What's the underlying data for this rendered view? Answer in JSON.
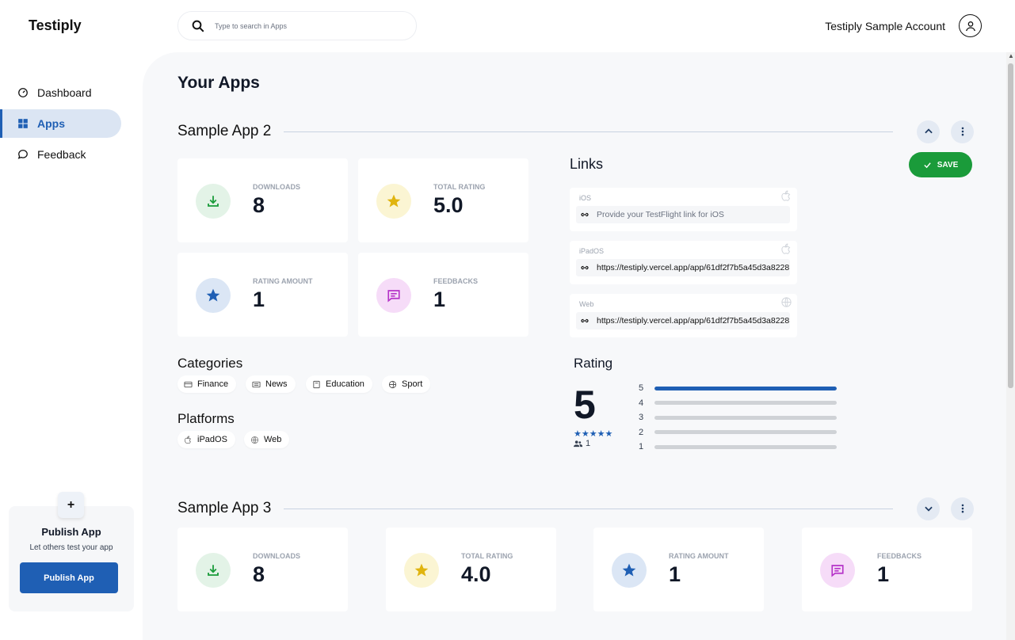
{
  "brand": "Testiply",
  "search": {
    "placeholder": "Type to search in Apps"
  },
  "account": {
    "name": "Testiply Sample Account"
  },
  "nav": {
    "items": [
      {
        "label": "Dashboard",
        "icon": "dashboard-icon"
      },
      {
        "label": "Apps",
        "icon": "grid-icon",
        "active": true
      },
      {
        "label": "Feedback",
        "icon": "chat-icon"
      }
    ]
  },
  "publish": {
    "plus": "+",
    "title": "Publish App",
    "subtitle": "Let others test your app",
    "button": "Publish App"
  },
  "page_title": "Your Apps",
  "apps": [
    {
      "name": "Sample App 2",
      "expanded": true,
      "stats": [
        {
          "label": "DOWNLOADS",
          "value": "8",
          "icon": "download-icon",
          "color": "#1a9b3a",
          "bg": "#e3f3e7"
        },
        {
          "label": "TOTAL RATING",
          "value": "5.0",
          "icon": "star-icon",
          "color": "#e0b40f",
          "bg": "#fbf5d3"
        },
        {
          "label": "RATING AMOUNT",
          "value": "1",
          "icon": "badge-star-icon",
          "color": "#1f5fb4",
          "bg": "#dbe6f5"
        },
        {
          "label": "FEEDBACKS",
          "value": "1",
          "icon": "message-icon",
          "color": "#b532c8",
          "bg": "#f6dcf8"
        }
      ],
      "categories_title": "Categories",
      "categories": [
        {
          "label": "Finance",
          "icon": "card-icon"
        },
        {
          "label": "News",
          "icon": "newspaper-icon"
        },
        {
          "label": "Education",
          "icon": "book-icon"
        },
        {
          "label": "Sport",
          "icon": "ball-icon"
        }
      ],
      "platforms_title": "Platforms",
      "platforms": [
        {
          "label": "iPadOS",
          "icon": "apple-icon"
        },
        {
          "label": "Web",
          "icon": "globe-icon"
        }
      ],
      "links_title": "Links",
      "save_label": "SAVE",
      "links": [
        {
          "label": "iOS",
          "value": "",
          "placeholder": "Provide your TestFlight link for iOS",
          "icon": "apple-icon"
        },
        {
          "label": "iPadOS",
          "value": "https://testiply.vercel.app/app/61df2f7b5a45d3a8228",
          "icon": "apple-icon"
        },
        {
          "label": "Web",
          "value": "https://testiply.vercel.app/app/61df2f7b5a45d3a8228",
          "icon": "globe-icon"
        }
      ],
      "rating": {
        "title": "Rating",
        "score": "5",
        "stars": "★★★★★",
        "count": "1",
        "distribution": [
          {
            "label": "5",
            "fraction": 1.0
          },
          {
            "label": "4",
            "fraction": 0
          },
          {
            "label": "3",
            "fraction": 0
          },
          {
            "label": "2",
            "fraction": 0
          },
          {
            "label": "1",
            "fraction": 0
          }
        ]
      }
    },
    {
      "name": "Sample App 3",
      "expanded": false,
      "stats": [
        {
          "label": "DOWNLOADS",
          "value": "8",
          "icon": "download-icon",
          "color": "#1a9b3a",
          "bg": "#e3f3e7"
        },
        {
          "label": "TOTAL RATING",
          "value": "4.0",
          "icon": "star-icon",
          "color": "#e0b40f",
          "bg": "#fbf5d3"
        },
        {
          "label": "RATING AMOUNT",
          "value": "1",
          "icon": "badge-star-icon",
          "color": "#1f5fb4",
          "bg": "#dbe6f5"
        },
        {
          "label": "FEEDBACKS",
          "value": "1",
          "icon": "message-icon",
          "color": "#b532c8",
          "bg": "#f6dcf8"
        }
      ]
    }
  ]
}
